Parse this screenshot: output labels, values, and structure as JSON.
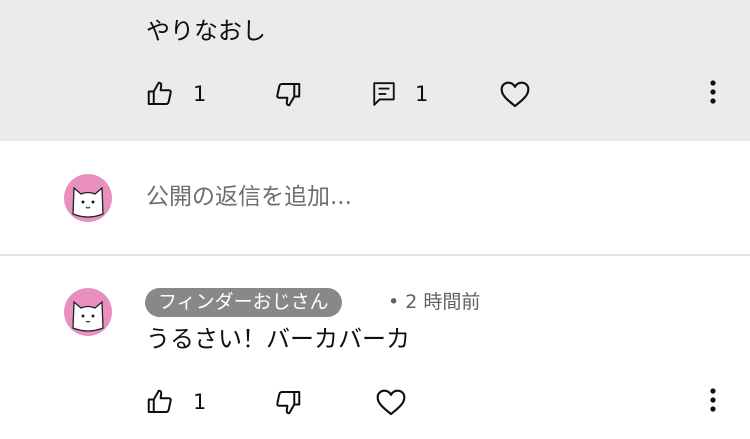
{
  "top_comment": {
    "text": "やりなおし",
    "like_count": "1",
    "reply_count": "1"
  },
  "reply_box": {
    "placeholder": "公開の返信を追加..."
  },
  "reply": {
    "author": "フィンダーおじさん",
    "time": "• 2 時間前",
    "text": "うるさい！バーカバーカ",
    "like_count": "1"
  },
  "icons": {
    "like": "thumb-up-icon",
    "dislike": "thumb-down-icon",
    "reply": "reply-comment-icon",
    "heart": "heart-icon",
    "more": "more-vertical-icon"
  },
  "colors": {
    "highlight_bg": "#ebebeb",
    "avatar_bg": "#e98fbf",
    "author_chip_bg": "#888888",
    "secondary_text": "#606060"
  }
}
